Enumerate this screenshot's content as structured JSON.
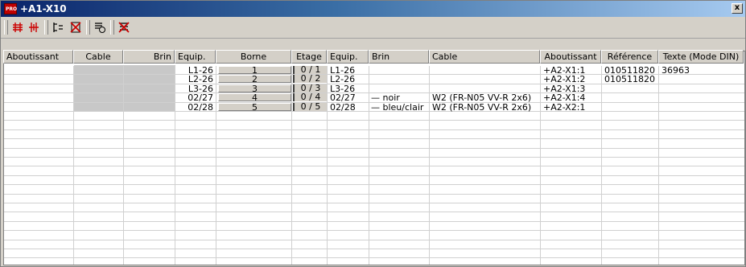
{
  "window": {
    "title": "+A1-X10",
    "app_badge": "PRO",
    "close_label": "x"
  },
  "toolbar": {
    "buttons": [
      {
        "icon": "terminal-strip-left-icon"
      },
      {
        "icon": "terminal-strip-right-icon"
      },
      {
        "icon": "insert-terminal-icon"
      },
      {
        "icon": "delete-terminal-icon"
      },
      {
        "icon": "cable-list-icon"
      },
      {
        "icon": "delete-cable-icon"
      }
    ]
  },
  "table": {
    "columns": [
      "Aboutissant",
      "Cable",
      "Brin",
      "Equip.",
      "Borne",
      "Etage",
      "Equip.",
      "Brin",
      "Cable",
      "Aboutissant",
      "Référence",
      "Texte (Mode DIN)"
    ],
    "rows": [
      {
        "equip_left": "L1-26",
        "borne": "1",
        "etage": "0 / 1",
        "equip_right": "L1-26",
        "brin": "",
        "cable": "",
        "aboutissant": "+A2-X1:1",
        "reference": "010511820",
        "texte": "36963"
      },
      {
        "equip_left": "L2-26",
        "borne": "2",
        "etage": "0 / 2",
        "equip_right": "L2-26",
        "brin": "",
        "cable": "",
        "aboutissant": "+A2-X1:2",
        "reference": "010511820",
        "texte": ""
      },
      {
        "equip_left": "L3-26",
        "borne": "3",
        "etage": "0 / 3",
        "equip_right": "L3-26",
        "brin": "",
        "cable": "",
        "aboutissant": "+A2-X1:3",
        "reference": "",
        "texte": ""
      },
      {
        "equip_left": "02/27",
        "borne": "4",
        "etage": "0 / 4",
        "equip_right": "02/27",
        "brin": "— noir",
        "cable": "W2 (FR-N05 VV-R 2x6)",
        "aboutissant": "+A2-X1:4",
        "reference": "",
        "texte": ""
      },
      {
        "equip_left": "02/28",
        "borne": "5",
        "etage": "0 / 5",
        "equip_right": "02/28",
        "brin": "— bleu/clair",
        "cable": "W2 (FR-N05 VV-R 2x6)",
        "aboutissant": "+A2-X2:1",
        "reference": "",
        "texte": ""
      }
    ]
  },
  "colors": {
    "title_bg": "#0a246a",
    "window_bg": "#d4d0c8",
    "grid_bg": "#ffffff",
    "shaded_block": "#c8c8c8",
    "icon_red": "#cc0000"
  }
}
